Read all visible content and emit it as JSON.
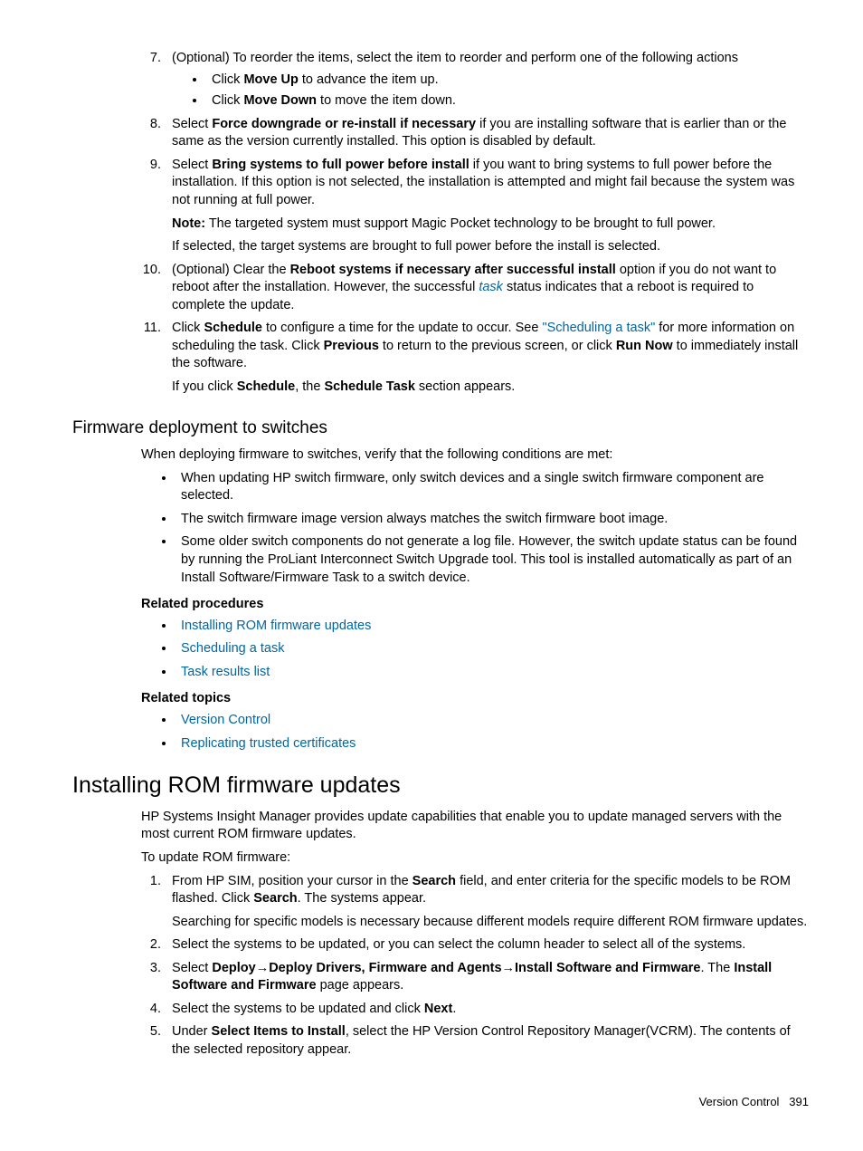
{
  "list1": {
    "i7_num": "7.",
    "i7_a": "(Optional) To reorder the items, select the item to reorder and perform one of the following actions",
    "i7_b1_a": "Click ",
    "i7_b1_b": "Move Up",
    "i7_b1_c": " to advance the item up.",
    "i7_b2_a": "Click ",
    "i7_b2_b": "Move Down",
    "i7_b2_c": " to move the item down.",
    "i8_num": "8.",
    "i8_a": "Select ",
    "i8_b": "Force downgrade or re-install if necessary",
    "i8_c": " if you are installing software that is earlier than or the same as the version currently installed. This option is disabled by default.",
    "i9_num": "9.",
    "i9_a": "Select ",
    "i9_b": "Bring systems to full power before install",
    "i9_c": " if you want to bring systems to full power before the installation. If this option is not selected, the installation is attempted and might fail because the system was not running at full power.",
    "i9_note_a": "Note:",
    "i9_note_b": " The targeted system must support Magic Pocket technology to be brought to full power.",
    "i9_p2": "If selected, the target systems are brought to full power before the install is selected.",
    "i10_num": "10.",
    "i10_a": "(Optional) Clear the ",
    "i10_b": "Reboot systems if necessary after successful install",
    "i10_c": " option if you do not want to reboot after the installation. However, the successful ",
    "i10_d": "task",
    "i10_e": " status indicates that a reboot is required to complete the update.",
    "i11_num": "11.",
    "i11_a": "Click ",
    "i11_b": "Schedule",
    "i11_c": " to configure a time for the update to occur. See ",
    "i11_d": "\"Scheduling a task\"",
    "i11_e": " for more information on scheduling the task. Click ",
    "i11_f": "Previous",
    "i11_g": " to return to the previous screen, or click ",
    "i11_h": "Run Now",
    "i11_i": " to immediately install the software.",
    "i11_p2_a": "If you click ",
    "i11_p2_b": "Schedule",
    "i11_p2_c": ", the ",
    "i11_p2_d": "Schedule Task",
    "i11_p2_e": " section appears."
  },
  "h_firmware": "Firmware deployment to switches",
  "fw_intro": "When deploying firmware to switches, verify that the following conditions are met:",
  "fw_b1": "When updating HP switch firmware, only switch devices and a single switch firmware component are selected.",
  "fw_b2": "The switch firmware image version always matches the switch firmware boot image.",
  "fw_b3": "Some older switch components do not generate a log file. However, the switch update status can be found by running the ProLiant Interconnect Switch Upgrade tool. This tool is installed automatically as part of an Install Software/Firmware Task to a switch device.",
  "rel_proc": "Related procedures",
  "rp1": "Installing ROM firmware updates",
  "rp2": "Scheduling a task",
  "rp3": "Task results list",
  "rel_top": "Related topics",
  "rt1": "Version Control",
  "rt2": "Replicating trusted certificates",
  "h_rom": "Installing ROM firmware updates",
  "rom_p1": "HP Systems Insight Manager provides update capabilities that enable you to update managed servers with the most current ROM firmware updates.",
  "rom_p2": "To update ROM firmware:",
  "rom": {
    "i1_num": "1.",
    "i1_a": "From HP SIM, position your cursor in the ",
    "i1_b": "Search",
    "i1_c": " field, and enter criteria for the specific models to be ROM flashed. Click ",
    "i1_d": "Search",
    "i1_e": ". The systems appear.",
    "i1_p2": "Searching for specific models is necessary because different models require different ROM firmware updates.",
    "i2_num": "2.",
    "i2": "Select the systems to be updated, or you can select the column header to select all of the systems.",
    "i3_num": "3.",
    "i3_a": "Select ",
    "i3_b": "Deploy",
    "i3_c": "Deploy Drivers, Firmware and Agents",
    "i3_d": "Install Software and Firmware",
    "i3_e": ". The ",
    "i3_f": "Install Software and Firmware",
    "i3_g": " page appears.",
    "i4_num": "4.",
    "i4_a": "Select the systems to be updated and click ",
    "i4_b": "Next",
    "i4_c": ".",
    "i5_num": "5.",
    "i5_a": "Under ",
    "i5_b": "Select Items to Install",
    "i5_c": ", select the HP Version Control Repository Manager(VCRM). The contents of the selected repository appear."
  },
  "footer_a": "Version Control",
  "footer_b": "391"
}
